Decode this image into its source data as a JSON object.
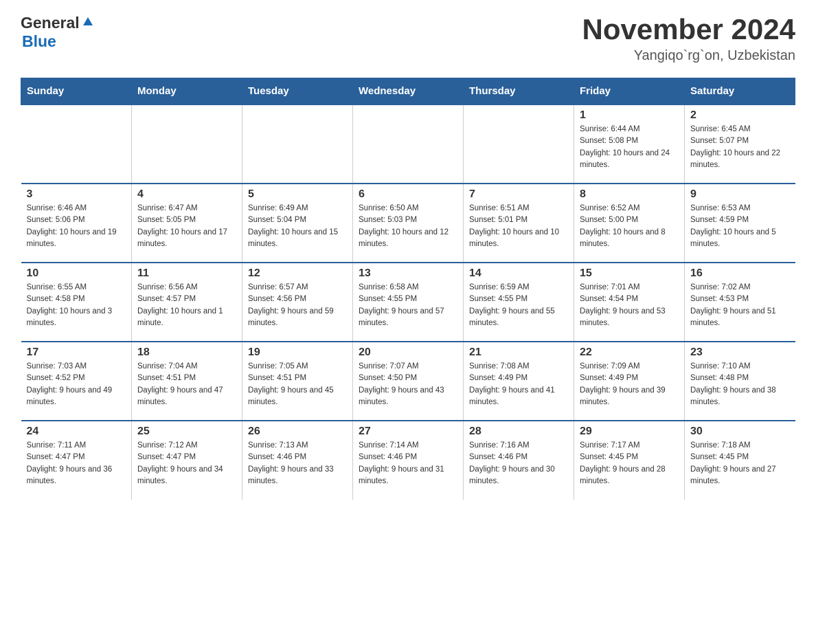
{
  "header": {
    "logo_general": "General",
    "logo_blue": "Blue",
    "month_title": "November 2024",
    "location": "Yangiqo`rg`on, Uzbekistan"
  },
  "days_of_week": [
    "Sunday",
    "Monday",
    "Tuesday",
    "Wednesday",
    "Thursday",
    "Friday",
    "Saturday"
  ],
  "weeks": [
    [
      {
        "day": "",
        "sunrise": "",
        "sunset": "",
        "daylight": ""
      },
      {
        "day": "",
        "sunrise": "",
        "sunset": "",
        "daylight": ""
      },
      {
        "day": "",
        "sunrise": "",
        "sunset": "",
        "daylight": ""
      },
      {
        "day": "",
        "sunrise": "",
        "sunset": "",
        "daylight": ""
      },
      {
        "day": "",
        "sunrise": "",
        "sunset": "",
        "daylight": ""
      },
      {
        "day": "1",
        "sunrise": "Sunrise: 6:44 AM",
        "sunset": "Sunset: 5:08 PM",
        "daylight": "Daylight: 10 hours and 24 minutes."
      },
      {
        "day": "2",
        "sunrise": "Sunrise: 6:45 AM",
        "sunset": "Sunset: 5:07 PM",
        "daylight": "Daylight: 10 hours and 22 minutes."
      }
    ],
    [
      {
        "day": "3",
        "sunrise": "Sunrise: 6:46 AM",
        "sunset": "Sunset: 5:06 PM",
        "daylight": "Daylight: 10 hours and 19 minutes."
      },
      {
        "day": "4",
        "sunrise": "Sunrise: 6:47 AM",
        "sunset": "Sunset: 5:05 PM",
        "daylight": "Daylight: 10 hours and 17 minutes."
      },
      {
        "day": "5",
        "sunrise": "Sunrise: 6:49 AM",
        "sunset": "Sunset: 5:04 PM",
        "daylight": "Daylight: 10 hours and 15 minutes."
      },
      {
        "day": "6",
        "sunrise": "Sunrise: 6:50 AM",
        "sunset": "Sunset: 5:03 PM",
        "daylight": "Daylight: 10 hours and 12 minutes."
      },
      {
        "day": "7",
        "sunrise": "Sunrise: 6:51 AM",
        "sunset": "Sunset: 5:01 PM",
        "daylight": "Daylight: 10 hours and 10 minutes."
      },
      {
        "day": "8",
        "sunrise": "Sunrise: 6:52 AM",
        "sunset": "Sunset: 5:00 PM",
        "daylight": "Daylight: 10 hours and 8 minutes."
      },
      {
        "day": "9",
        "sunrise": "Sunrise: 6:53 AM",
        "sunset": "Sunset: 4:59 PM",
        "daylight": "Daylight: 10 hours and 5 minutes."
      }
    ],
    [
      {
        "day": "10",
        "sunrise": "Sunrise: 6:55 AM",
        "sunset": "Sunset: 4:58 PM",
        "daylight": "Daylight: 10 hours and 3 minutes."
      },
      {
        "day": "11",
        "sunrise": "Sunrise: 6:56 AM",
        "sunset": "Sunset: 4:57 PM",
        "daylight": "Daylight: 10 hours and 1 minute."
      },
      {
        "day": "12",
        "sunrise": "Sunrise: 6:57 AM",
        "sunset": "Sunset: 4:56 PM",
        "daylight": "Daylight: 9 hours and 59 minutes."
      },
      {
        "day": "13",
        "sunrise": "Sunrise: 6:58 AM",
        "sunset": "Sunset: 4:55 PM",
        "daylight": "Daylight: 9 hours and 57 minutes."
      },
      {
        "day": "14",
        "sunrise": "Sunrise: 6:59 AM",
        "sunset": "Sunset: 4:55 PM",
        "daylight": "Daylight: 9 hours and 55 minutes."
      },
      {
        "day": "15",
        "sunrise": "Sunrise: 7:01 AM",
        "sunset": "Sunset: 4:54 PM",
        "daylight": "Daylight: 9 hours and 53 minutes."
      },
      {
        "day": "16",
        "sunrise": "Sunrise: 7:02 AM",
        "sunset": "Sunset: 4:53 PM",
        "daylight": "Daylight: 9 hours and 51 minutes."
      }
    ],
    [
      {
        "day": "17",
        "sunrise": "Sunrise: 7:03 AM",
        "sunset": "Sunset: 4:52 PM",
        "daylight": "Daylight: 9 hours and 49 minutes."
      },
      {
        "day": "18",
        "sunrise": "Sunrise: 7:04 AM",
        "sunset": "Sunset: 4:51 PM",
        "daylight": "Daylight: 9 hours and 47 minutes."
      },
      {
        "day": "19",
        "sunrise": "Sunrise: 7:05 AM",
        "sunset": "Sunset: 4:51 PM",
        "daylight": "Daylight: 9 hours and 45 minutes."
      },
      {
        "day": "20",
        "sunrise": "Sunrise: 7:07 AM",
        "sunset": "Sunset: 4:50 PM",
        "daylight": "Daylight: 9 hours and 43 minutes."
      },
      {
        "day": "21",
        "sunrise": "Sunrise: 7:08 AM",
        "sunset": "Sunset: 4:49 PM",
        "daylight": "Daylight: 9 hours and 41 minutes."
      },
      {
        "day": "22",
        "sunrise": "Sunrise: 7:09 AM",
        "sunset": "Sunset: 4:49 PM",
        "daylight": "Daylight: 9 hours and 39 minutes."
      },
      {
        "day": "23",
        "sunrise": "Sunrise: 7:10 AM",
        "sunset": "Sunset: 4:48 PM",
        "daylight": "Daylight: 9 hours and 38 minutes."
      }
    ],
    [
      {
        "day": "24",
        "sunrise": "Sunrise: 7:11 AM",
        "sunset": "Sunset: 4:47 PM",
        "daylight": "Daylight: 9 hours and 36 minutes."
      },
      {
        "day": "25",
        "sunrise": "Sunrise: 7:12 AM",
        "sunset": "Sunset: 4:47 PM",
        "daylight": "Daylight: 9 hours and 34 minutes."
      },
      {
        "day": "26",
        "sunrise": "Sunrise: 7:13 AM",
        "sunset": "Sunset: 4:46 PM",
        "daylight": "Daylight: 9 hours and 33 minutes."
      },
      {
        "day": "27",
        "sunrise": "Sunrise: 7:14 AM",
        "sunset": "Sunset: 4:46 PM",
        "daylight": "Daylight: 9 hours and 31 minutes."
      },
      {
        "day": "28",
        "sunrise": "Sunrise: 7:16 AM",
        "sunset": "Sunset: 4:46 PM",
        "daylight": "Daylight: 9 hours and 30 minutes."
      },
      {
        "day": "29",
        "sunrise": "Sunrise: 7:17 AM",
        "sunset": "Sunset: 4:45 PM",
        "daylight": "Daylight: 9 hours and 28 minutes."
      },
      {
        "day": "30",
        "sunrise": "Sunrise: 7:18 AM",
        "sunset": "Sunset: 4:45 PM",
        "daylight": "Daylight: 9 hours and 27 minutes."
      }
    ]
  ]
}
